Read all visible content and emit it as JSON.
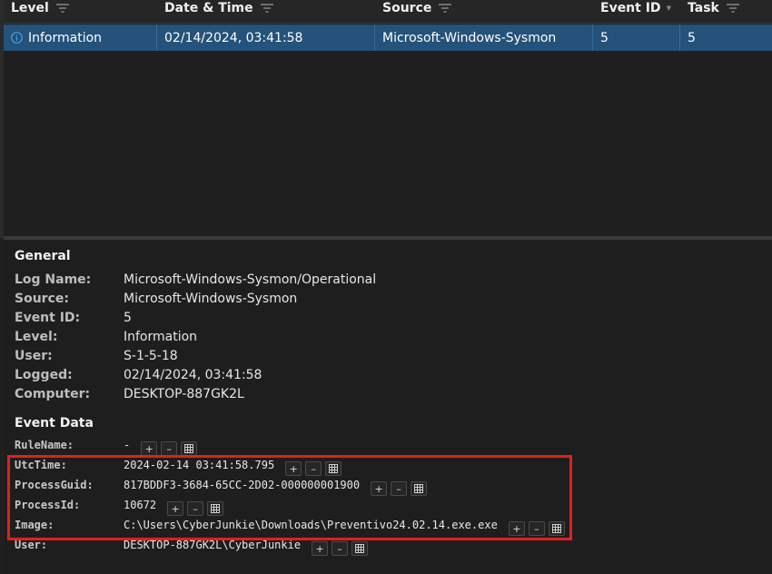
{
  "grid": {
    "headers": {
      "level": "Level",
      "datetime": "Date & Time",
      "source": "Source",
      "event_id": "Event ID",
      "task": "Task"
    },
    "row": {
      "level": "Information",
      "datetime": "02/14/2024, 03:41:58",
      "source": "Microsoft-Windows-Sysmon",
      "event_id": "5",
      "task": "5"
    }
  },
  "general": {
    "title": "General",
    "fields": [
      {
        "key": "Log Name:",
        "value": "Microsoft-Windows-Sysmon/Operational"
      },
      {
        "key": "Source:",
        "value": "Microsoft-Windows-Sysmon"
      },
      {
        "key": "Event ID:",
        "value": "5"
      },
      {
        "key": "Level:",
        "value": "Information"
      },
      {
        "key": "User:",
        "value": "S-1-5-18"
      },
      {
        "key": "Logged:",
        "value": "02/14/2024, 03:41:58"
      },
      {
        "key": "Computer:",
        "value": "DESKTOP-887GK2L"
      }
    ]
  },
  "event_data": {
    "title": "Event Data",
    "fields": [
      {
        "key": "RuleName:",
        "value": "-"
      },
      {
        "key": "UtcTime:",
        "value": "2024-02-14 03:41:58.795"
      },
      {
        "key": "ProcessGuid:",
        "value": "817BDDF3-3684-65CC-2D02-000000001900"
      },
      {
        "key": "ProcessId:",
        "value": "10672"
      },
      {
        "key": "Image:",
        "value": "C:\\Users\\CyberJunkie\\Downloads\\Preventivo24.02.14.exe.exe"
      },
      {
        "key": "User:",
        "value": "DESKTOP-887GK2L\\CyberJunkie"
      }
    ],
    "button_labels": {
      "add": "+",
      "remove": "–"
    }
  },
  "colors": {
    "selection": "#24527a",
    "highlight_border": "#e0201e",
    "info_icon": "#4a9de0"
  },
  "icons": {
    "level": "info-icon",
    "header_filter": "filter-icon",
    "table_view": "grid-icon"
  }
}
